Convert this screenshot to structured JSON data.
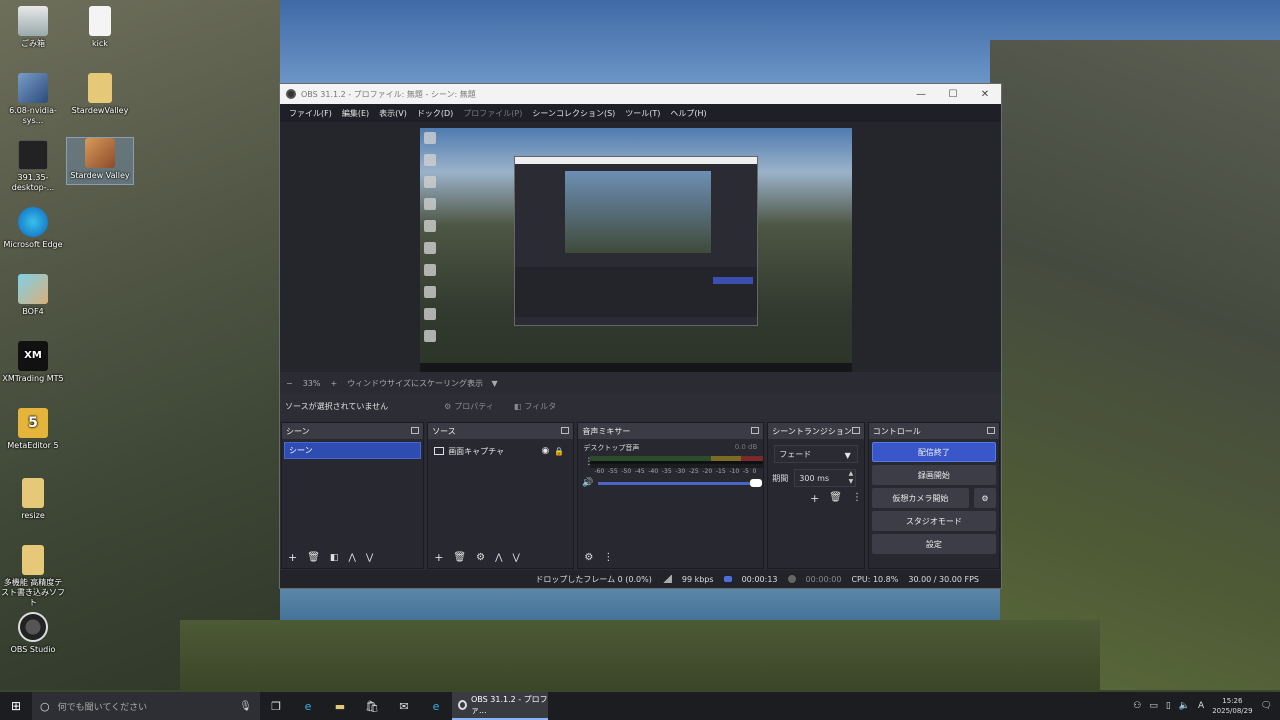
{
  "desktop": {
    "icons": [
      {
        "label": "ごみ箱",
        "icon": "recycle-bin-icon"
      },
      {
        "label": "kick",
        "icon": "document-icon"
      },
      {
        "label": "6.08-nvidia-sys...",
        "icon": "installer-icon"
      },
      {
        "label": "StardewValley",
        "icon": "folder-icon"
      },
      {
        "label": "391.35-desktop-...",
        "icon": "nvidia-icon"
      },
      {
        "label": "Stardew Valley",
        "icon": "stardew-icon"
      },
      {
        "label": "Microsoft Edge",
        "icon": "edge-icon"
      },
      {
        "label": "BOF4",
        "icon": "game-icon"
      },
      {
        "label": "XMTrading MT5",
        "icon": "mt5-icon"
      },
      {
        "label": "MetaEditor 5",
        "icon": "metaeditor-icon"
      },
      {
        "label": "resize",
        "icon": "folder-icon"
      },
      {
        "label": "多機能 高精度テスト書き込みソフト",
        "icon": "folder-icon"
      },
      {
        "label": "OBS Studio",
        "icon": "obs-icon"
      }
    ]
  },
  "window": {
    "title": "OBS 31.1.2 - プロファイル: 無題 - シーン: 無題",
    "controls": {
      "minimize": "—",
      "maximize": "☐",
      "close": "✕"
    }
  },
  "menu": [
    {
      "label": "ファイル(F)",
      "enabled": true
    },
    {
      "label": "編集(E)",
      "enabled": true
    },
    {
      "label": "表示(V)",
      "enabled": true
    },
    {
      "label": "ドック(D)",
      "enabled": true
    },
    {
      "label": "プロファイル(P)",
      "enabled": false
    },
    {
      "label": "シーンコレクション(S)",
      "enabled": true
    },
    {
      "label": "ツール(T)",
      "enabled": true
    },
    {
      "label": "ヘルプ(H)",
      "enabled": true
    }
  ],
  "preview": {
    "zoom_minus": "−",
    "zoom_value": "33%",
    "zoom_plus": "+",
    "scaling_mode": "ウィンドウサイズにスケーリング表示"
  },
  "source_toolbar": {
    "status": "ソースが選択されていません",
    "properties_label": "プロパティ",
    "filters_label": "フィルタ"
  },
  "docks": {
    "scenes": {
      "title": "シーン",
      "items": [
        "シーン"
      ]
    },
    "sources": {
      "title": "ソース",
      "items": [
        "画面キャプチャ"
      ]
    },
    "mixer": {
      "title": "音声ミキサー",
      "channel": "デスクトップ音声",
      "level": "0.0 dB",
      "ticks": [
        "-60",
        "-55",
        "-50",
        "-45",
        "-40",
        "-35",
        "-30",
        "-25",
        "-20",
        "-15",
        "-10",
        "-5",
        "0"
      ]
    },
    "transitions": {
      "title": "シーントランジション",
      "selected": "フェード",
      "duration_label": "期間",
      "duration_value": "300 ms"
    },
    "controls": {
      "title": "コントロール",
      "stop_stream": "配信終了",
      "start_recording": "録画開始",
      "start_virtualcam": "仮想カメラ開始",
      "studio_mode": "スタジオモード",
      "settings": "設定"
    }
  },
  "status": {
    "dropped_frames": "ドロップしたフレーム 0 (0.0%)",
    "bitrate": "99 kbps",
    "stream_time": "00:00:13",
    "record_time": "00:00:00",
    "cpu": "CPU: 10.8%",
    "fps": "30.00 / 30.00 FPS"
  },
  "taskbar": {
    "search_placeholder": "何でも聞いてください",
    "active_app": "OBS 31.1.2 - プロファ...",
    "ime": "A",
    "time": "15:26",
    "date": "2025/08/29"
  }
}
